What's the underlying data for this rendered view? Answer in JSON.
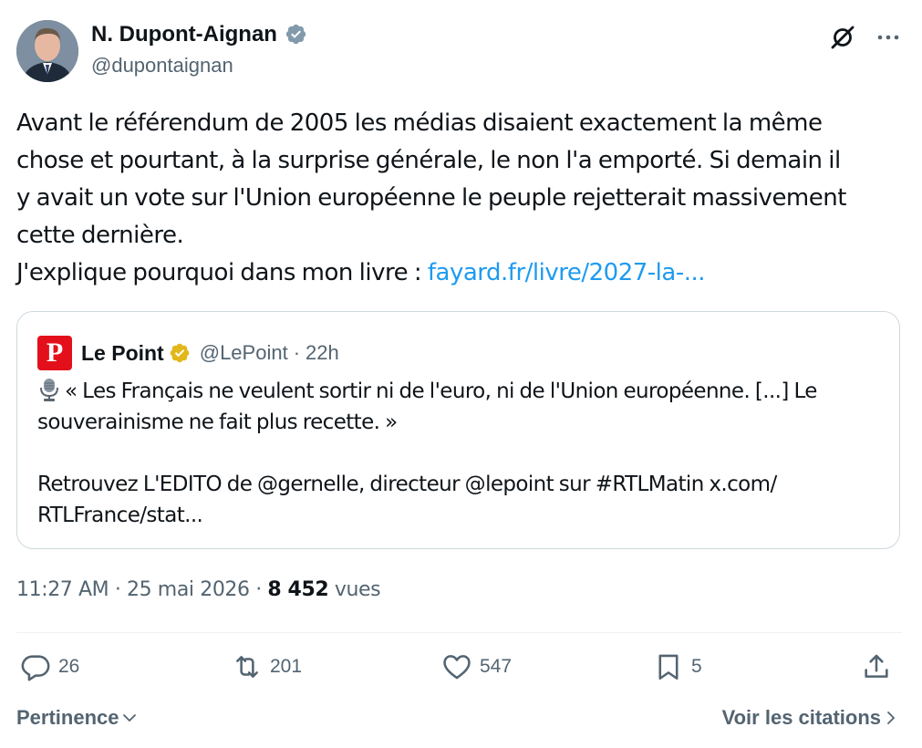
{
  "author": {
    "display_name": "N. Dupont-Aignan",
    "handle": "@dupontaignan",
    "verified_color": "#829aab"
  },
  "tweet": {
    "text_lines": [
      "Avant le référendum de 2005 les médias disaient exactement la même",
      "chose et pourtant, à la surprise générale, le non l'a emporté. Si demain il",
      "y avait un vote sur l'Union européenne le peuple rejetterait massivement",
      "cette dernière."
    ],
    "text_last_prefix": "J'explique pourquoi dans mon livre : ",
    "link_text": "fayard.fr/livre/2027-la-...",
    "link_color": "#1d9bf0"
  },
  "quote": {
    "logo_letter": "P",
    "logo_color": "#e3101b",
    "name": "Le Point",
    "handle": "@LePoint",
    "separator": "·",
    "time": "22h",
    "mic_icon": "studio-microphone-icon",
    "line1": "« Les Français ne veulent sortir ni de l'euro, ni de l'Union européenne. [...] Le",
    "line2": "souverainisme ne fait plus recette. »",
    "line3": "Retrouvez L'EDITO de @gernelle, directeur @lepoint sur #RTLMatin x.com/",
    "line4": "RTLFrance/stat..."
  },
  "meta": {
    "time": "11:27 AM",
    "sep1": "·",
    "date": "25 mai 2026",
    "sep2": "·",
    "views_count": "8 452",
    "views_label": "vues"
  },
  "actions": {
    "replies": "26",
    "reposts": "201",
    "likes": "547",
    "bookmarks": "5"
  },
  "footer": {
    "sort_label": "Pertinence",
    "quotes_label": "Voir les citations"
  }
}
